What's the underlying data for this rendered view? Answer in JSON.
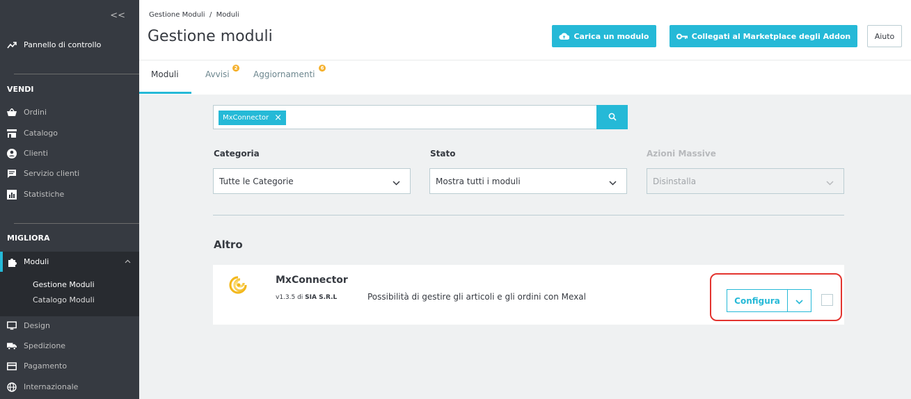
{
  "sidebar": {
    "collapse_label": "<<",
    "dashboard": "Pannello di controllo",
    "section_sell": "VENDI",
    "sell_items": [
      {
        "label": "Ordini",
        "icon": "basket-icon"
      },
      {
        "label": "Catalogo",
        "icon": "store-icon"
      },
      {
        "label": "Clienti",
        "icon": "account-icon"
      },
      {
        "label": "Servizio clienti",
        "icon": "chat-icon"
      },
      {
        "label": "Statistiche",
        "icon": "chart-icon"
      }
    ],
    "section_improve": "MIGLIORA",
    "modules_label": "Moduli",
    "modules_sub": [
      "Gestione Moduli",
      "Catalogo Moduli"
    ],
    "improve_items": [
      {
        "label": "Design",
        "icon": "desktop-icon"
      },
      {
        "label": "Spedizione",
        "icon": "truck-icon"
      },
      {
        "label": "Pagamento",
        "icon": "card-icon"
      },
      {
        "label": "Internazionale",
        "icon": "globe-icon"
      }
    ]
  },
  "header": {
    "breadcrumb": "Gestione Moduli  /  Moduli",
    "title": "Gestione moduli",
    "upload_btn": "Carica un modulo",
    "marketplace_btn": "Collegati al Marketplace degli Addon",
    "help_btn": "Aiuto",
    "tabs": [
      {
        "label": "Moduli",
        "badge": ""
      },
      {
        "label": "Avvisi",
        "badge": "2"
      },
      {
        "label": "Aggiornamenti",
        "badge": "6"
      }
    ]
  },
  "search": {
    "tag": "MxConnector"
  },
  "filters": {
    "category_label": "Categoria",
    "category_value": "Tutte le Categorie",
    "status_label": "Stato",
    "status_value": "Mostra tutti i moduli",
    "bulk_label": "Azioni Massive",
    "bulk_value": "Disinstalla"
  },
  "section": {
    "title": "Altro"
  },
  "module": {
    "name": "MxConnector",
    "version": "v1.3.5 di ",
    "author": "SIA S.R.L",
    "description": "Possibilità di gestire gli articoli e gli ordini con Mexal",
    "configure_btn": "Configura"
  },
  "colors": {
    "accent": "#25b9d7",
    "sidebar_bg": "#363a41",
    "badge": "#f5b12e",
    "highlight": "#e3342f"
  }
}
